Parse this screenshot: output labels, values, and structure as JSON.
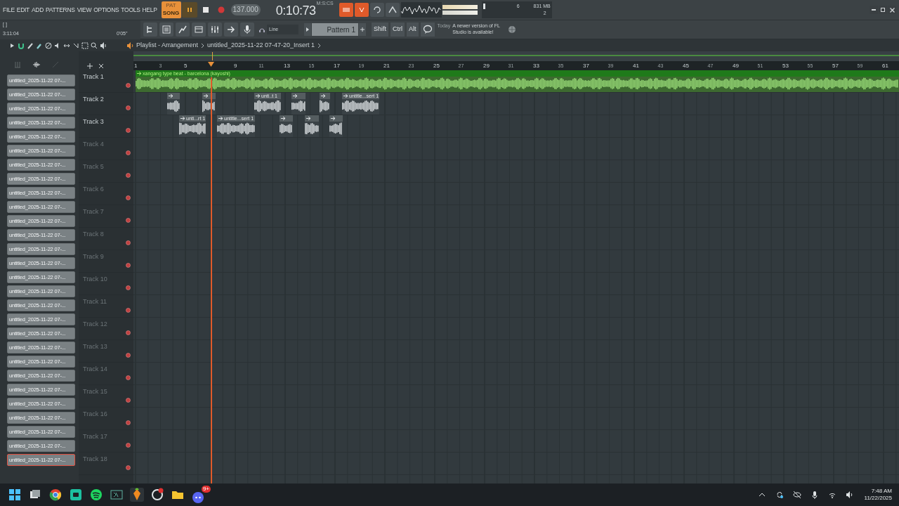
{
  "menu": [
    "FILE",
    "EDIT",
    "ADD",
    "PATTERNS",
    "VIEW",
    "OPTIONS",
    "TOOLS",
    "HELP"
  ],
  "transport": {
    "pat_label": "PAT",
    "song_label": "SONG",
    "song_mode": true,
    "playing": true,
    "tempo": "137.000",
    "time": "0:10:73",
    "time_unit": "M:S:CS",
    "cpu": "6",
    "memory": "831 MB",
    "polyphony": "2"
  },
  "hint": {
    "text": "[ ]",
    "position": "3:11:04",
    "offset": "0'05\""
  },
  "toolbar": {
    "input": "Line",
    "pattern": "Pattern 1",
    "keys": [
      "Shift",
      "Ctrl",
      "Alt"
    ],
    "news_day": "Today",
    "news_text": "A newer version of FL Studio is available!"
  },
  "breadcrumb": [
    "Playlist - Arrangement",
    "untitled_2025-11-22 07-47-20_Insert 1"
  ],
  "ruler": [
    "1",
    "3",
    "5",
    "9",
    "11",
    "13",
    "15",
    "17",
    "19",
    "21",
    "23",
    "25",
    "27",
    "29",
    "31",
    "33",
    "35",
    "37",
    "39",
    "41",
    "43",
    "45",
    "47",
    "49",
    "51",
    "53",
    "55",
    "57",
    "59",
    "61"
  ],
  "picker": [
    {
      "label": "untitled_2025-11-22 07-...",
      "selected": false
    },
    {
      "label": "untitled_2025-11-22 07-...",
      "selected": false
    },
    {
      "label": "untitled_2025-11-22 07-...",
      "selected": false
    },
    {
      "label": "untitled_2025-11-22 07-...",
      "selected": false
    },
    {
      "label": "untitled_2025-11-22 07-...",
      "selected": false
    },
    {
      "label": "untitled_2025-11-22 07-...",
      "selected": false
    },
    {
      "label": "untitled_2025-11-22 07-...",
      "selected": false
    },
    {
      "label": "untitled_2025-11-22 07-...",
      "selected": false
    },
    {
      "label": "untitled_2025-11-22 07-...",
      "selected": false
    },
    {
      "label": "untitled_2025-11-22 07-...",
      "selected": false
    },
    {
      "label": "untitled_2025-11-22 07-...",
      "selected": false
    },
    {
      "label": "untitled_2025-11-22 07-...",
      "selected": false
    },
    {
      "label": "untitled_2025-11-22 07-...",
      "selected": false
    },
    {
      "label": "untitled_2025-11-22 07-...",
      "selected": false
    },
    {
      "label": "untitled_2025-11-22 07-...",
      "selected": false
    },
    {
      "label": "untitled_2025-11-22 07-...",
      "selected": false
    },
    {
      "label": "untitled_2025-11-22 07-...",
      "selected": false
    },
    {
      "label": "untitled_2025-11-22 07-...",
      "selected": false
    },
    {
      "label": "untitled_2025-11-22 07-...",
      "selected": false
    },
    {
      "label": "untitled_2025-11-22 07-...",
      "selected": false
    },
    {
      "label": "untitled_2025-11-22 07-...",
      "selected": false
    },
    {
      "label": "untitled_2025-11-22 07-...",
      "selected": false
    },
    {
      "label": "untitled_2025-11-22 07-...",
      "selected": false
    },
    {
      "label": "untitled_2025-11-22 07-...",
      "selected": false
    },
    {
      "label": "untitled_2025-11-22 07-...",
      "selected": false
    },
    {
      "label": "untitled_2025-11-22 07-...",
      "selected": false
    },
    {
      "label": "untitled_2025-11-22 07-...",
      "selected": false
    },
    {
      "label": "untitled_2025-11-22 07-...",
      "selected": true
    }
  ],
  "tracks": [
    {
      "name": "Track 1",
      "clips": [
        {
          "kind": "labeled",
          "label": "xangang type beat - barcelona (kayoshi)"
        }
      ]
    },
    {
      "name": "Track 2",
      "clips": [
        {
          "kind": "unlabeled"
        },
        {
          "kind": "unlabeled"
        },
        {
          "kind": "labeled",
          "label": "unti..t 1"
        },
        {
          "kind": "unlabeled"
        },
        {
          "kind": "unlabeled"
        },
        {
          "kind": "labeled",
          "label": "untitle...sert 1"
        }
      ]
    },
    {
      "name": "Track 3",
      "clips": [
        {
          "kind": "labeled",
          "label": "unti...rt 1"
        },
        {
          "kind": "labeled",
          "label": "untitle...sert 1"
        },
        {
          "kind": "unlabeled"
        },
        {
          "kind": "unlabeled"
        },
        {
          "kind": "unlabeled"
        }
      ]
    },
    {
      "name": "Track 4"
    },
    {
      "name": "Track 5"
    },
    {
      "name": "Track 6"
    },
    {
      "name": "Track 7"
    },
    {
      "name": "Track 8"
    },
    {
      "name": "Track 9"
    },
    {
      "name": "Track 10"
    },
    {
      "name": "Track 11"
    },
    {
      "name": "Track 12"
    },
    {
      "name": "Track 13"
    },
    {
      "name": "Track 14"
    },
    {
      "name": "Track 15"
    },
    {
      "name": "Track 16"
    },
    {
      "name": "Track 17"
    },
    {
      "name": "Track 18"
    }
  ],
  "taskbar": {
    "discord_badge": "9+",
    "time": "7:48 AM",
    "date": "11/22/2025"
  }
}
